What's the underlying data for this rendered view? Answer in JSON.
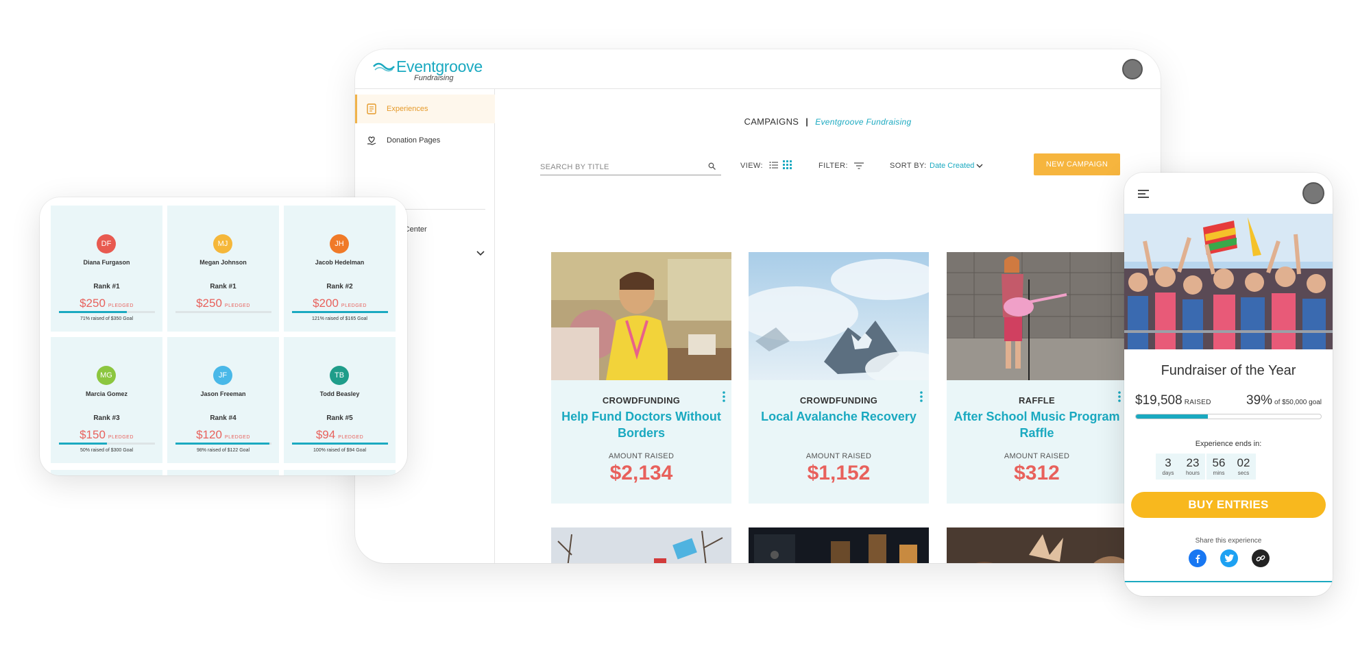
{
  "colors": {
    "teal": "#1aa9c0",
    "orange": "#f6b53e",
    "coral": "#e8615c",
    "card_bg": "#eaf6f8",
    "yellow": "#f8b81e"
  },
  "desktop": {
    "logo_name": "Eventgroove",
    "logo_sub": "Fundraising",
    "sidebar": {
      "items": [
        {
          "label": "Experiences",
          "icon": "document-icon",
          "active": true
        },
        {
          "label": "Donation Pages",
          "icon": "heart-hand-icon",
          "active": false
        },
        {
          "label": "Help Center",
          "icon": "help-circle-icon",
          "active": false
        }
      ]
    },
    "breadcrumb": {
      "section": "CAMPAIGNS",
      "separator": "|",
      "org": "Eventgroove Fundraising"
    },
    "toolbar": {
      "search_placeholder": "SEARCH BY TITLE",
      "view_label": "VIEW:",
      "filter_label": "FILTER:",
      "sort_label": "SORT BY:",
      "sort_value": "Date Created",
      "new_campaign": "NEW CAMPAIGN"
    },
    "campaigns": [
      {
        "type": "CROWDFUNDING",
        "title": "Help Fund Doctors Without Borders",
        "amount_label": "AMOUNT RAISED",
        "amount": "$2,134"
      },
      {
        "type": "CROWDFUNDING",
        "title": "Local Avalanche Recovery",
        "amount_label": "AMOUNT RAISED",
        "amount": "$1,152"
      },
      {
        "type": "RAFFLE",
        "title": "After School Music Program Raffle",
        "amount_label": "AMOUNT RAISED",
        "amount": "$312"
      }
    ]
  },
  "tablet": {
    "pledged_label": "PLEDGED",
    "leaders": [
      {
        "initials": "DF",
        "name": "Diana Furgason",
        "rank": "Rank #1",
        "amount": "$250",
        "goal": "71% raised of $350 Goal",
        "progress": 0.71,
        "color": "#e85a50"
      },
      {
        "initials": "MJ",
        "name": "Megan Johnson",
        "rank": "Rank #1",
        "amount": "$250",
        "goal": "",
        "progress": 0,
        "color": "#f5b73a"
      },
      {
        "initials": "JH",
        "name": "Jacob Hedelman",
        "rank": "Rank #2",
        "amount": "$200",
        "goal": "121% raised of $165 Goal",
        "progress": 1.0,
        "color": "#f07a28"
      },
      {
        "initials": "MG",
        "name": "Marcia Gomez",
        "rank": "Rank #3",
        "amount": "$150",
        "goal": "50% raised of $300 Goal",
        "progress": 0.5,
        "color": "#8cc63f"
      },
      {
        "initials": "JF",
        "name": "Jason Freeman",
        "rank": "Rank #4",
        "amount": "$120",
        "goal": "98% raised of $122 Goal",
        "progress": 0.98,
        "color": "#49b8e8"
      },
      {
        "initials": "TB",
        "name": "Todd Beasley",
        "rank": "Rank #5",
        "amount": "$94",
        "goal": "100% raised of $94 Goal",
        "progress": 1.0,
        "color": "#1f9d8a"
      }
    ]
  },
  "phone": {
    "title": "Fundraiser of the Year",
    "raised": "$19,508",
    "raised_label": "RAISED",
    "percent": "39%",
    "goal_text": "of $50,000 goal",
    "progress": 0.39,
    "ends_label": "Experience ends in:",
    "countdown": [
      {
        "value": "3",
        "unit": "days"
      },
      {
        "value": "23",
        "unit": "hours"
      },
      {
        "value": "56",
        "unit": "mins"
      },
      {
        "value": "02",
        "unit": "secs"
      }
    ],
    "buy_label": "BUY ENTRIES",
    "share_label": "Share this experience",
    "share_icons": [
      "facebook-icon",
      "twitter-icon",
      "link-icon"
    ]
  }
}
